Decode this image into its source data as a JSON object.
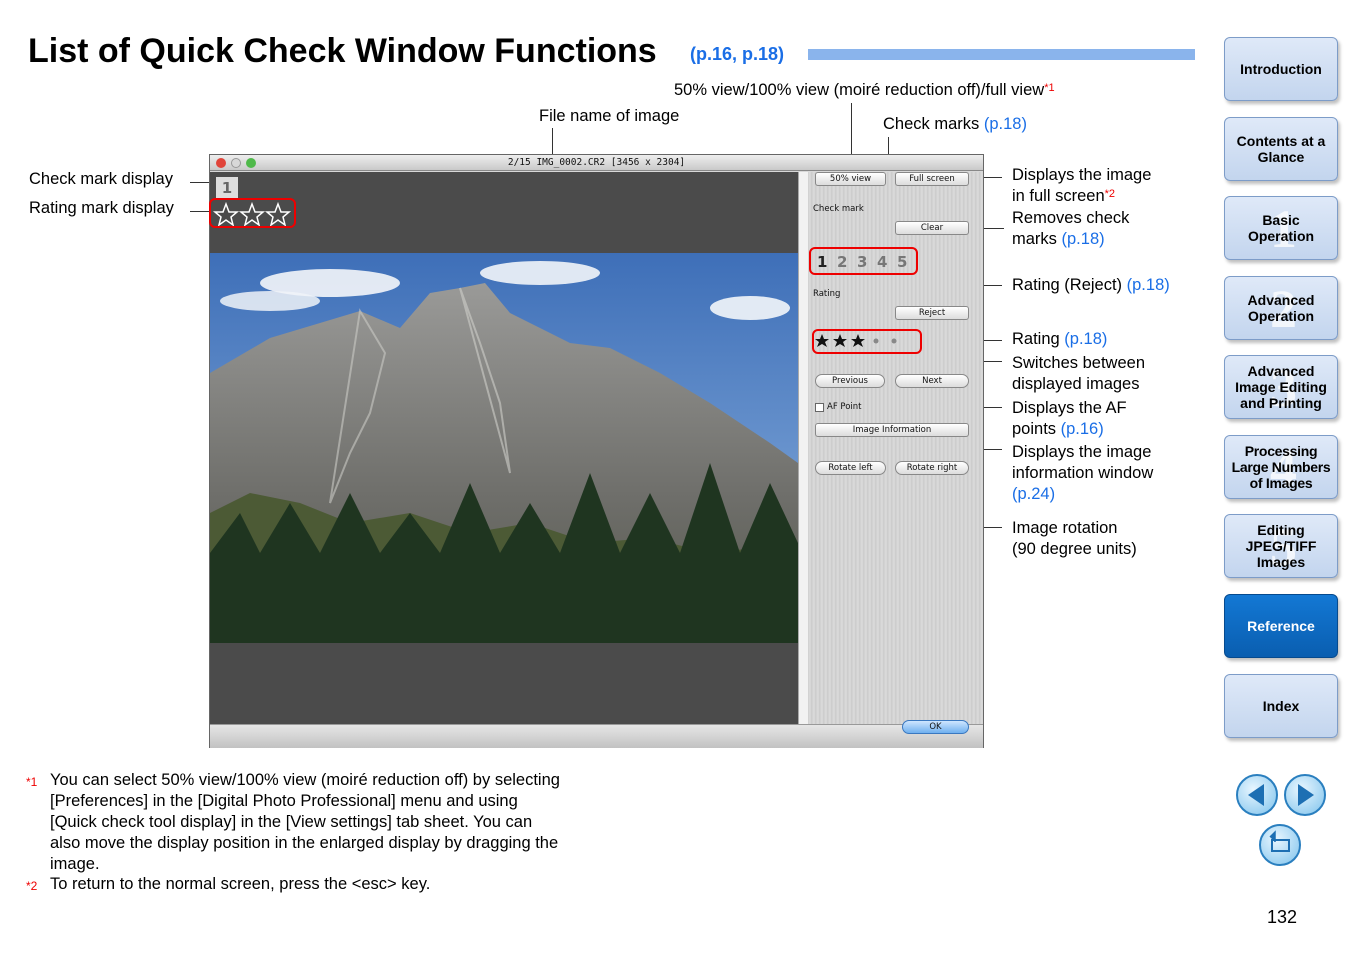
{
  "page": {
    "title": "List of Quick Check Window Functions",
    "title_ref": "(p.16, p.18)",
    "page_number": "132"
  },
  "callouts": {
    "view_mode": "50% view/100% view (moiré reduction off)/full view",
    "view_mode_note": "*1",
    "file_name": "File name of image",
    "check_marks": "Check marks",
    "check_marks_ref": "(p.18)",
    "check_mark_display": "Check mark display",
    "rating_mark_display": "Rating mark display",
    "full_screen_1": "Displays the image",
    "full_screen_2": "in full screen",
    "full_screen_note": "*2",
    "clear_1": "Removes check",
    "clear_2": "marks",
    "clear_ref": "(p.18)",
    "reject": "Rating (Reject)",
    "reject_ref": "(p.18)",
    "rating": "Rating",
    "rating_ref": "(p.18)",
    "switch_1": "Switches between",
    "switch_2": "displayed images",
    "af_1": "Displays the AF",
    "af_2": "points",
    "af_ref": "(p.16)",
    "info_1": "Displays the image",
    "info_2": "information window",
    "info_ref": "(p.24)",
    "rotate_1": "Image rotation",
    "rotate_2": "(90 degree units)"
  },
  "window": {
    "title": "2/15 IMG_0002.CR2 [3456 x 2304]",
    "check_number": "1",
    "btn_50": "50% view",
    "btn_full": "Full screen",
    "check_mark_label": "Check mark",
    "btn_clear": "Clear",
    "check_numbers": [
      "1",
      "2",
      "3",
      "4",
      "5"
    ],
    "rating_label": "Rating",
    "btn_reject": "Reject",
    "btn_previous": "Previous",
    "btn_next": "Next",
    "af_point": "AF Point",
    "btn_image_info": "Image Information",
    "btn_rotate_left": "Rotate left",
    "btn_rotate_right": "Rotate right",
    "btn_ok": "OK"
  },
  "footnotes": [
    {
      "mark": "*1",
      "lines": [
        "You can select 50% view/100% view (moiré reduction off) by selecting",
        "[Preferences] in the [Digital Photo Professional] menu and using",
        "[Quick check tool display] in the [View settings] tab sheet. You can",
        "also move the display position in the enlarged display by dragging the",
        "image."
      ]
    },
    {
      "mark": "*2",
      "lines": [
        "To return to the normal screen, press the <esc> key."
      ]
    }
  ],
  "nav": [
    {
      "label": "Introduction",
      "num": ""
    },
    {
      "label": "Contents at a Glance",
      "num": ""
    },
    {
      "label": "Basic Operation",
      "num": "1"
    },
    {
      "label": "Advanced Operation",
      "num": "2"
    },
    {
      "label": "Advanced Image Editing and Printing",
      "num": "3"
    },
    {
      "label": "Processing Large Numbers of Images",
      "num": "4"
    },
    {
      "label": "Editing JPEG/TIFF Images",
      "num": "5"
    },
    {
      "label": "Reference",
      "num": ""
    },
    {
      "label": "Index",
      "num": ""
    }
  ],
  "colors": {
    "link": "#1a6ee6",
    "note": "#ee0000",
    "highlight": "#ee0000",
    "nav_active": "#0a6cc4"
  }
}
